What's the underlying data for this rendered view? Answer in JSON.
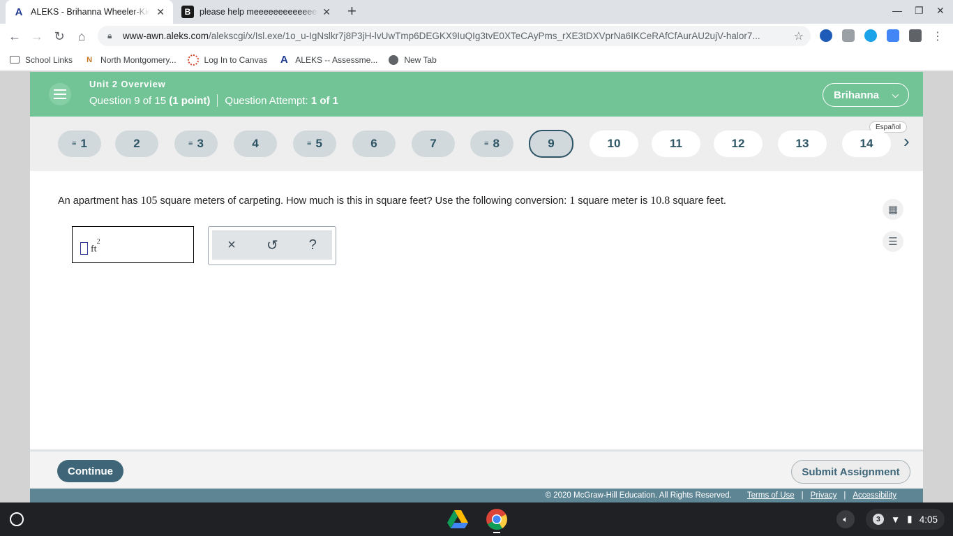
{
  "browser": {
    "tabs": [
      {
        "title": "ALEKS - Brihanna Wheeler-Kidd - Learn",
        "favicon": "aleks-logo-icon",
        "active": true
      },
      {
        "title": "please help meeeeeeeeeeeeeeeeeeee",
        "favicon": "brainly-logo-icon",
        "active": false
      }
    ],
    "url_host": "www-awn.aleks.com",
    "url_path": "/alekscgi/x/Isl.exe/1o_u-IgNslkr7j8P3jH-lvUwTmp6DEGKX9IuQIg3tvE0XTeCAyPms_rXE3tDXVprNa6IKCeRAfCfAurAU2ujV-halor7...",
    "bookmarks": [
      {
        "label": "School Links",
        "icon": "folder-icon"
      },
      {
        "label": "North Montgomery...",
        "icon": "north-montgomery-icon"
      },
      {
        "label": "Log In to Canvas",
        "icon": "canvas-icon"
      },
      {
        "label": "ALEKS -- Assessme...",
        "icon": "aleks-logo-icon"
      },
      {
        "label": "New Tab",
        "icon": "globe-icon"
      }
    ]
  },
  "header": {
    "unit_title": "Unit 2 Overview",
    "question_prefix": "Question 9 of 15",
    "question_points": "(1 point)",
    "attempt_label": "Question Attempt:",
    "attempt_value": "1 of 1",
    "user_name": "Brihanna",
    "accent_color": "#72c497"
  },
  "question_nav": {
    "language_label": "Español",
    "questions": [
      {
        "label": "1",
        "state": "answered"
      },
      {
        "label": "2",
        "state": "visited"
      },
      {
        "label": "3",
        "state": "answered"
      },
      {
        "label": "4",
        "state": "visited"
      },
      {
        "label": "5",
        "state": "answered"
      },
      {
        "label": "6",
        "state": "visited"
      },
      {
        "label": "7",
        "state": "visited"
      },
      {
        "label": "8",
        "state": "answered"
      },
      {
        "label": "9",
        "state": "current"
      },
      {
        "label": "10",
        "state": "unvisited"
      },
      {
        "label": "11",
        "state": "unvisited"
      },
      {
        "label": "12",
        "state": "unvisited"
      },
      {
        "label": "13",
        "state": "unvisited"
      },
      {
        "label": "14",
        "state": "unvisited"
      }
    ]
  },
  "question": {
    "text_1": "An apartment has ",
    "num_1": "105",
    "text_2": " square meters of carpeting. How much is this in square feet? Use the following conversion: ",
    "num_2": "1",
    "text_3": " square meter is ",
    "num_3": "10.8",
    "text_4": " square feet.",
    "answer_value": "",
    "answer_unit": "ft",
    "answer_unit_exp": "2"
  },
  "tools": {
    "clear_glyph": "×",
    "undo_glyph": "↺",
    "help_glyph": "?"
  },
  "footer_bar": {
    "continue_label": "Continue",
    "submit_label": "Submit Assignment",
    "copyright": "© 2020 McGraw-Hill Education. All Rights Reserved.",
    "links": [
      "Terms of Use",
      "Privacy",
      "Accessibility"
    ]
  },
  "shelf": {
    "notification_count": "3",
    "time": "4:05"
  }
}
